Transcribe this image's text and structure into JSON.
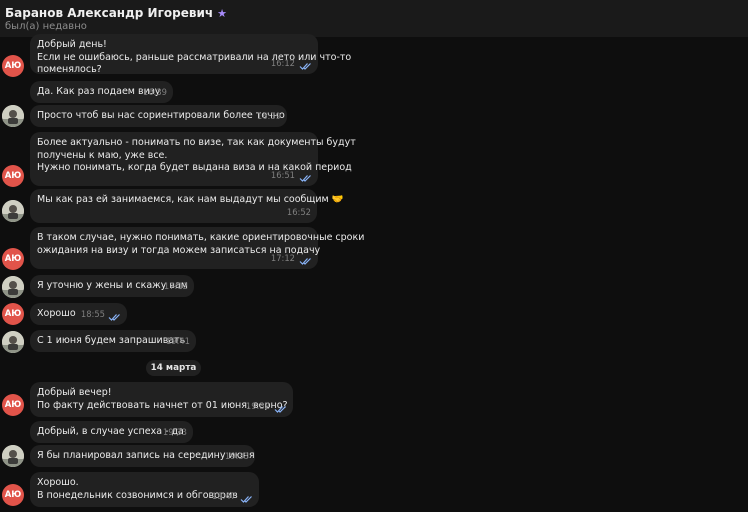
{
  "header": {
    "contact_name": "Баранов Александр Игоревич",
    "status": "был(а) недавно"
  },
  "avatars": {
    "initials": "АЮ"
  },
  "date_separator": "14 марта",
  "messages": [
    {
      "text": "Добрый день!\nЕсли не ошибаюсь, раньше рассматривали на лето или что-то\nпоменялось?",
      "time": "16:12",
      "read": true
    },
    {
      "text": "Да. Как раз подаем визу",
      "time": "16:39"
    },
    {
      "text": "Просто чтоб вы нас сориентировали более точно",
      "time": "16:39"
    },
    {
      "text": "Более актуально - понимать по визе, так как документы будут\nполучены к маю, уже все.\nНужно понимать, когда будет выдана виза и на какой период",
      "time": "16:51",
      "read": true
    },
    {
      "text": "Мы как раз ей занимаемся, как нам выдадут мы сообщим 🤝",
      "time": "16:52"
    },
    {
      "text": "В таком случае, нужно понимать, какие ориентировочные сроки\nожидания на визу  и тогда можем записаться на подачу",
      "time": "17:12",
      "read": true
    },
    {
      "text": "Я уточню у жены и скажу вам",
      "time": "17:12"
    },
    {
      "text": "Хорошо",
      "time": "18:55",
      "read": true
    },
    {
      "text": "С 1 июня будем запрашивать",
      "time": "19:41"
    },
    {
      "text": "Добрый вечер!\nПо факту действовать начнет от 01 июня, верно?",
      "time": "19:32",
      "read": true
    },
    {
      "text": "Добрый, в случае успеха - да",
      "time": "19:33"
    },
    {
      "text": "Я бы планировал запись на середину июня",
      "time": "19:33"
    },
    {
      "text": "Хорошо.\nВ понедельник созвонимся и обговорив",
      "time": "19:47",
      "read": true
    }
  ]
}
